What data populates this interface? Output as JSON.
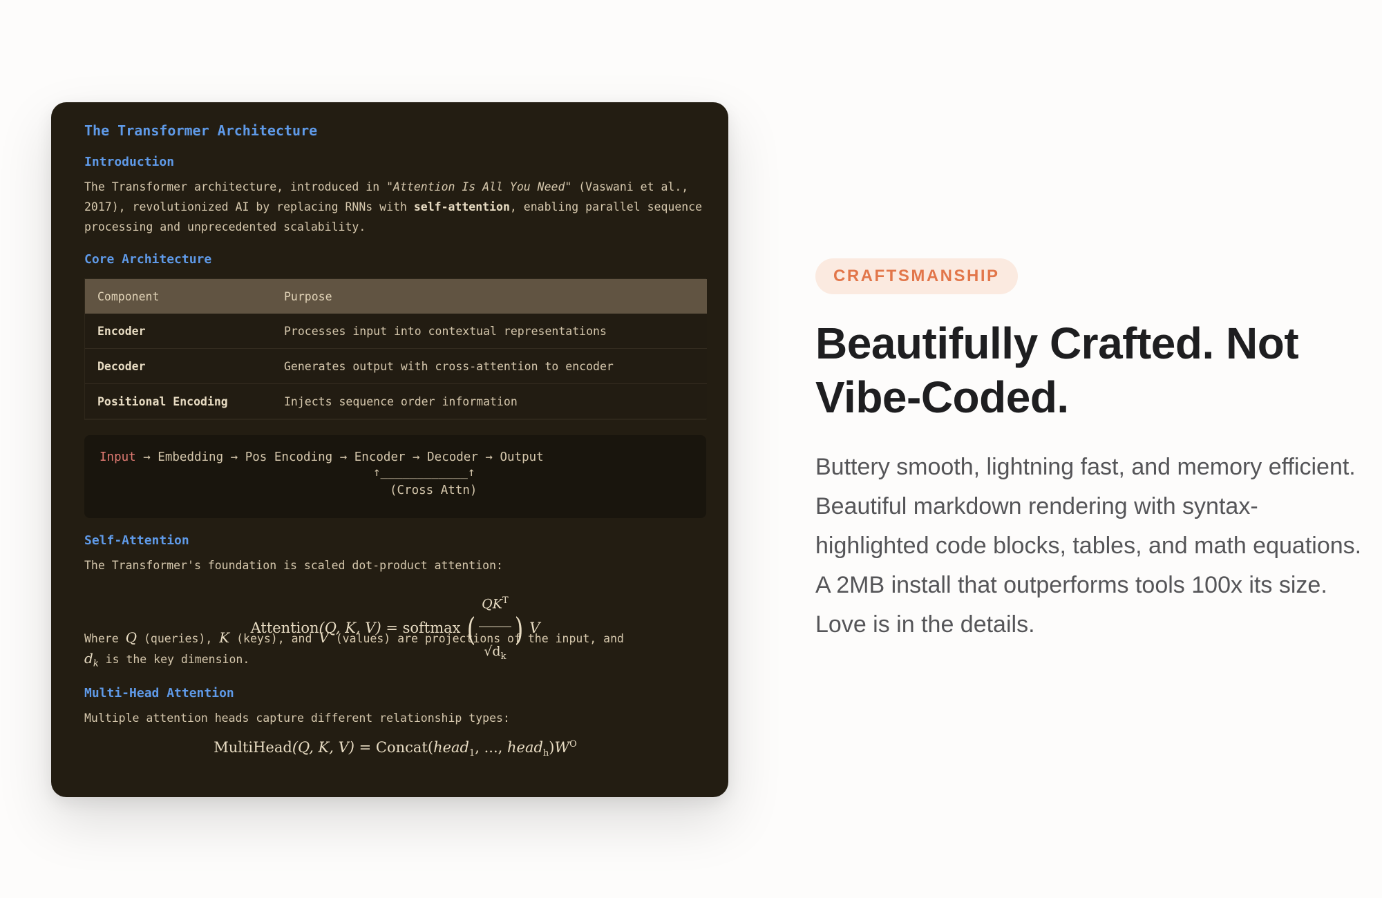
{
  "card": {
    "title": "The Transformer Architecture",
    "intro_heading": "Introduction",
    "intro_p1": "The Transformer architecture, introduced in ",
    "intro_em": "\"Attention Is All You Need\"",
    "intro_p2": " (Vaswani et al., 2017), revolutionized AI by replacing RNNs with ",
    "intro_strong": "self-attention",
    "intro_p3": ", enabling parallel sequence processing and unprecedented scalability.",
    "core_heading": "Core Architecture",
    "table": {
      "headers": [
        "Component",
        "Purpose"
      ],
      "rows": [
        [
          "Encoder",
          "Processes input into contextual representations"
        ],
        [
          "Decoder",
          "Generates output with cross-attention to encoder"
        ],
        [
          "Positional Encoding",
          "Injects sequence order information"
        ]
      ]
    },
    "code": {
      "keyword": "Input",
      "line1_rest": " → Embedding → Pos Encoding → Encoder → Decoder → Output",
      "line2": "↑____________↑",
      "line3": "(Cross Attn)"
    },
    "self_attention_heading": "Self-Attention",
    "self_attention_p": "The Transformer's foundation is scaled dot-product attention:",
    "formula1": {
      "lhs": "Attention",
      "args": "(Q, K, V) = softmax",
      "num": "QK",
      "num_sup": "T",
      "den": "√d",
      "den_sub": "k",
      "tail": "V"
    },
    "where": {
      "w1": "Where ",
      "q": "Q",
      "w2": " (queries), ",
      "k": "K",
      "w3": " (keys), and ",
      "v": "V",
      "w4": " (values) are projections of the input, and",
      "d": "d",
      "d_sub": "k",
      "w5": " is the key dimension."
    },
    "multihead_heading": "Multi-Head Attention",
    "multihead_p": "Multiple attention heads capture different relationship types:",
    "formula2": {
      "lhs": "MultiHead",
      "args": "(Q, K, V) = Concat(",
      "head1": "head",
      "head1_sub": "1",
      "mid": ", ..., ",
      "headh": "head",
      "headh_sub": "h",
      "close": ")W",
      "sup": "O"
    }
  },
  "badge": "CRAFTSMANSHIP",
  "headline": "Beautifully Crafted. Not Vibe-Coded.",
  "description": "Buttery smooth, lightning fast, and memory efficient. Beautiful markdown rendering with syntax-highlighted code blocks, tables, and math equations. A 2MB install that outperforms tools 100x its size. Love is in the details.",
  "colors": {
    "card_bg": "#231d12",
    "heading_blue": "#5f9ae8",
    "badge_text": "#e2764a",
    "badge_bg": "#fbeae0"
  }
}
